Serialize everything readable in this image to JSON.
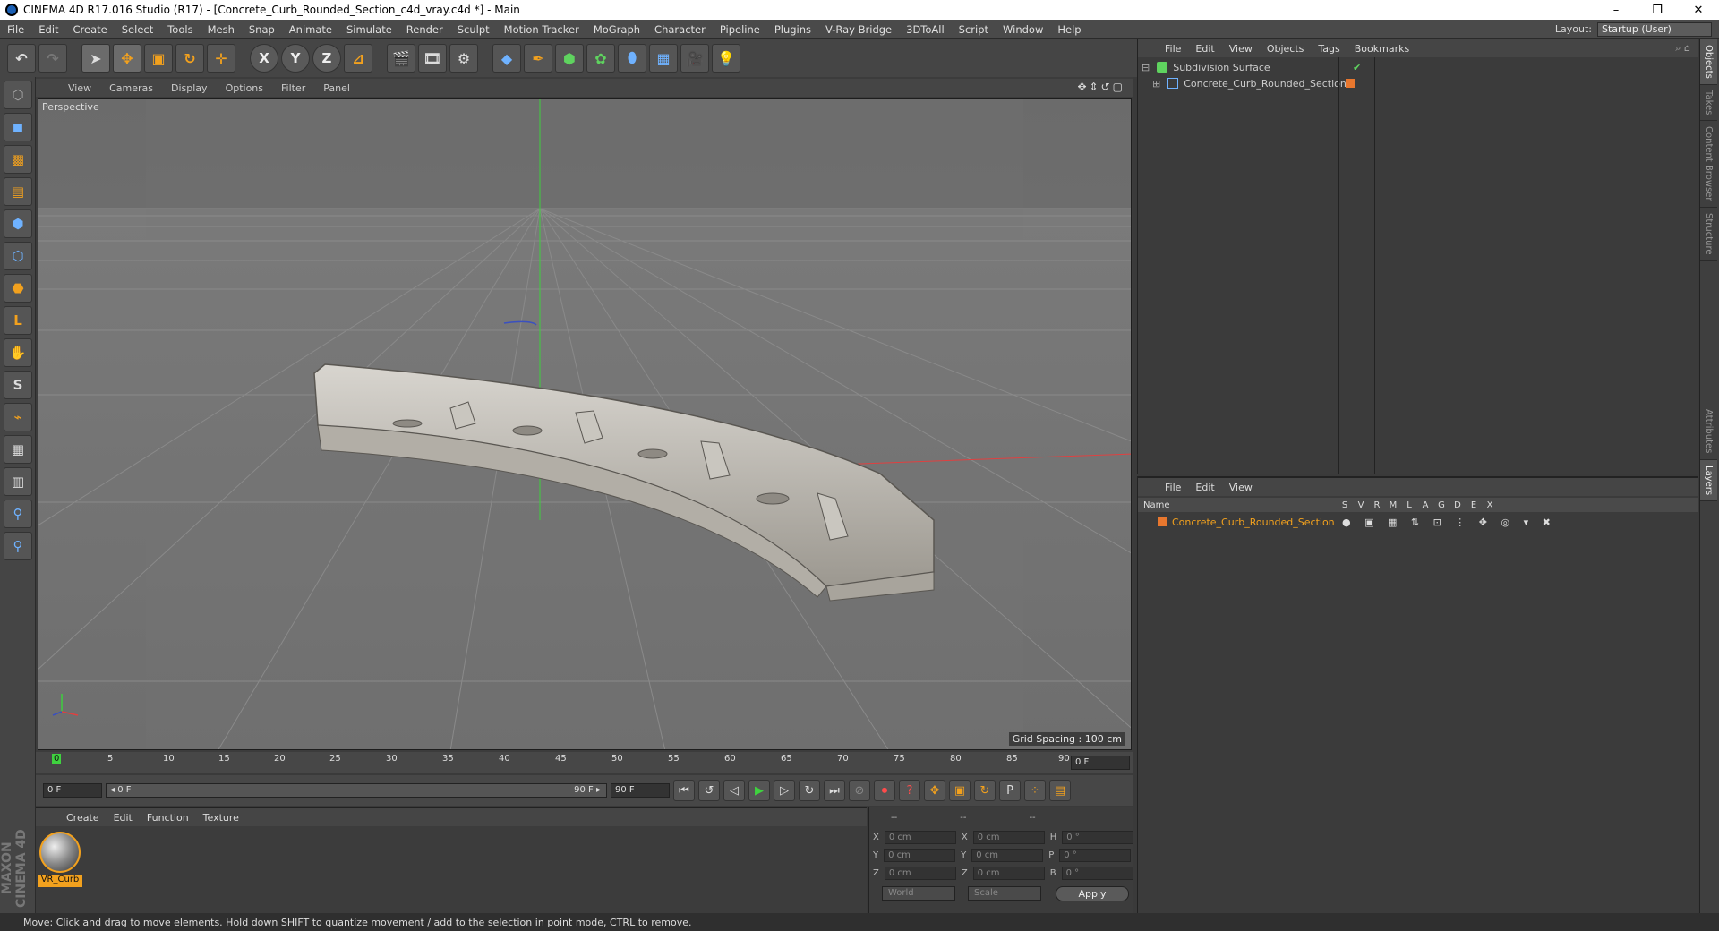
{
  "window": {
    "title": "CINEMA 4D R17.016 Studio (R17) - [Concrete_Curb_Rounded_Section_c4d_vray.c4d *] - Main",
    "minimize": "–",
    "restore": "❐",
    "close": "✕"
  },
  "menubar": {
    "items": [
      "File",
      "Edit",
      "Create",
      "Select",
      "Tools",
      "Mesh",
      "Snap",
      "Animate",
      "Simulate",
      "Render",
      "Sculpt",
      "Motion Tracker",
      "MoGraph",
      "Character",
      "Pipeline",
      "Plugins",
      "V-Ray Bridge",
      "3DToAll",
      "Script",
      "Window",
      "Help"
    ],
    "layout_label": "Layout:",
    "layout_value": "Startup (User)"
  },
  "toolbar": {
    "icons": [
      "undo-icon",
      "redo-icon",
      "select-icon",
      "move-icon",
      "scale-icon",
      "rotate-icon",
      "transform-icon",
      "x-axis-icon",
      "y-axis-icon",
      "z-axis-icon",
      "coordinate-system-icon",
      "render-view-icon",
      "render-picture-viewer-icon",
      "edit-render-settings-icon",
      "cube-icon",
      "pen-icon",
      "subdivision-icon",
      "array-icon",
      "deformer-icon",
      "floor-icon",
      "camera-icon",
      "light-icon"
    ],
    "x_label": "X",
    "y_label": "Y",
    "z_label": "Z"
  },
  "viewport": {
    "menu": [
      "View",
      "Cameras",
      "Display",
      "Options",
      "Filter",
      "Panel"
    ],
    "label": "Perspective",
    "grid_spacing": "Grid Spacing : 100 cm"
  },
  "timeline": {
    "ticks": [
      "0",
      "5",
      "10",
      "15",
      "20",
      "25",
      "30",
      "35",
      "40",
      "45",
      "50",
      "55",
      "60",
      "65",
      "70",
      "75",
      "80",
      "85",
      "90"
    ],
    "current_frame": "0 F"
  },
  "transport": {
    "start": "0 F",
    "range_start": "◂ 0 F",
    "range_end": "90 F ▸",
    "end": "90 F"
  },
  "material_manager": {
    "menu": [
      "Create",
      "Edit",
      "Function",
      "Texture"
    ],
    "material_name": "VR_Curb"
  },
  "coordinates": {
    "headers": [
      "--",
      "--",
      "--"
    ],
    "rows": [
      {
        "a": "X",
        "av": "0 cm",
        "b": "X",
        "bv": "0 cm",
        "c": "H",
        "cv": "0 °"
      },
      {
        "a": "Y",
        "av": "0 cm",
        "b": "Y",
        "bv": "0 cm",
        "c": "P",
        "cv": "0 °"
      },
      {
        "a": "Z",
        "av": "0 cm",
        "b": "Z",
        "bv": "0 cm",
        "c": "B",
        "cv": "0 °"
      }
    ],
    "mode": "World",
    "transform": "Scale",
    "apply": "Apply"
  },
  "object_manager": {
    "menu": [
      "File",
      "Edit",
      "View",
      "Objects",
      "Tags",
      "Bookmarks"
    ],
    "objects": [
      {
        "name": "Subdivision Surface",
        "color": "#5fd35f"
      },
      {
        "name": "Concrete_Curb_Rounded_Section",
        "color": "#f2a11e"
      }
    ]
  },
  "layer_manager": {
    "menu": [
      "File",
      "Edit",
      "View"
    ],
    "header_name": "Name",
    "columns": [
      "S",
      "V",
      "R",
      "M",
      "L",
      "A",
      "G",
      "D",
      "E",
      "X"
    ],
    "layer_name": "Concrete_Curb_Rounded_Section",
    "layer_color": "#e8772e"
  },
  "side_tabs": [
    "Objects",
    "Takes",
    "Content Browser",
    "Structure",
    "Attributes",
    "Layers"
  ],
  "status": "Move: Click and drag to move elements. Hold down SHIFT to quantize movement / add to the selection in point mode, CTRL to remove.",
  "branding": "MAXON CINEMA 4D",
  "colors": {
    "accent": "#f2a11e",
    "panel": "#3b3b3b",
    "viewport_bg": "#6a6a6a"
  }
}
